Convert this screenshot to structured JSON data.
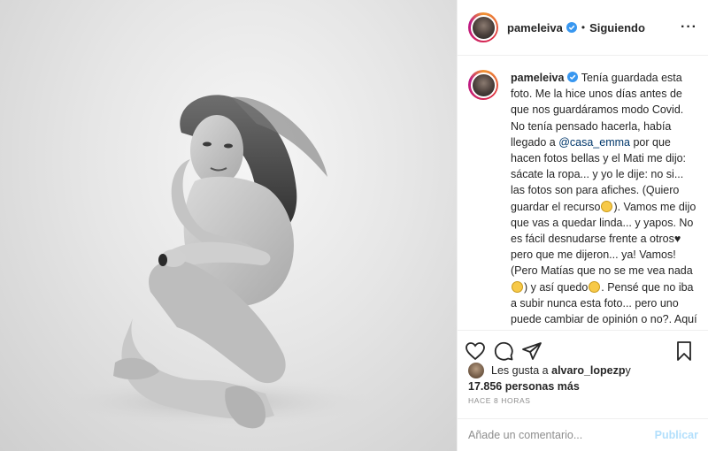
{
  "post": {
    "photo_icon": "photo-of-seated-woman",
    "photo_alt": ""
  },
  "header": {
    "username": "pameleiva",
    "separator": "•",
    "follow_status": "Siguiendo",
    "more_icon": "more-dots-icon",
    "more_label": "···"
  },
  "caption": {
    "username": "pameleiva",
    "text_1": "Tenía guardada esta foto. Me la hice unos días antes de que nos guardáramos modo Covid. No tenía pensado hacerla, había llegado a ",
    "mention": "@casa_emma",
    "text_2": " por que hacen fotos bellas y el Mati me dijo: sácate la ropa... y yo le dije: no si... las fotos son para afiches. (Quiero guardar el recurso",
    "text_3": "). Vamos me dijo que vas a quedar linda... y yapos. No es fácil desnudarse frente a otros",
    "heart": "♥",
    "text_4": " pero que me dijeron... ya! Vamos! (Pero Matías que no se me vea nada",
    "text_5": ") y así quedo",
    "text_6": ". Pensé que no iba a subir nunca esta foto... pero uno puede cambiar de opinión o no?. Aquí estamos trabajando en mi... sintiéndome orgullosa de mi misma, haciéndolo de manera consciente y..."
  },
  "actions": {
    "like_icon": "heart-icon",
    "comment_icon": "comment-icon",
    "share_icon": "share-icon",
    "save_icon": "bookmark-icon"
  },
  "likes": {
    "prefix": "Les gusta a ",
    "user": "alvaro_lopezp",
    "connector": " y",
    "count": "17.856 personas más"
  },
  "timestamp": "HACE 8 HORAS",
  "comment_box": {
    "placeholder": "Añade un comentario...",
    "publish_label": "Publicar"
  },
  "colors": {
    "mention": "#00376b",
    "publish_disabled": "#b2dffc",
    "verified": "#3897f0"
  }
}
